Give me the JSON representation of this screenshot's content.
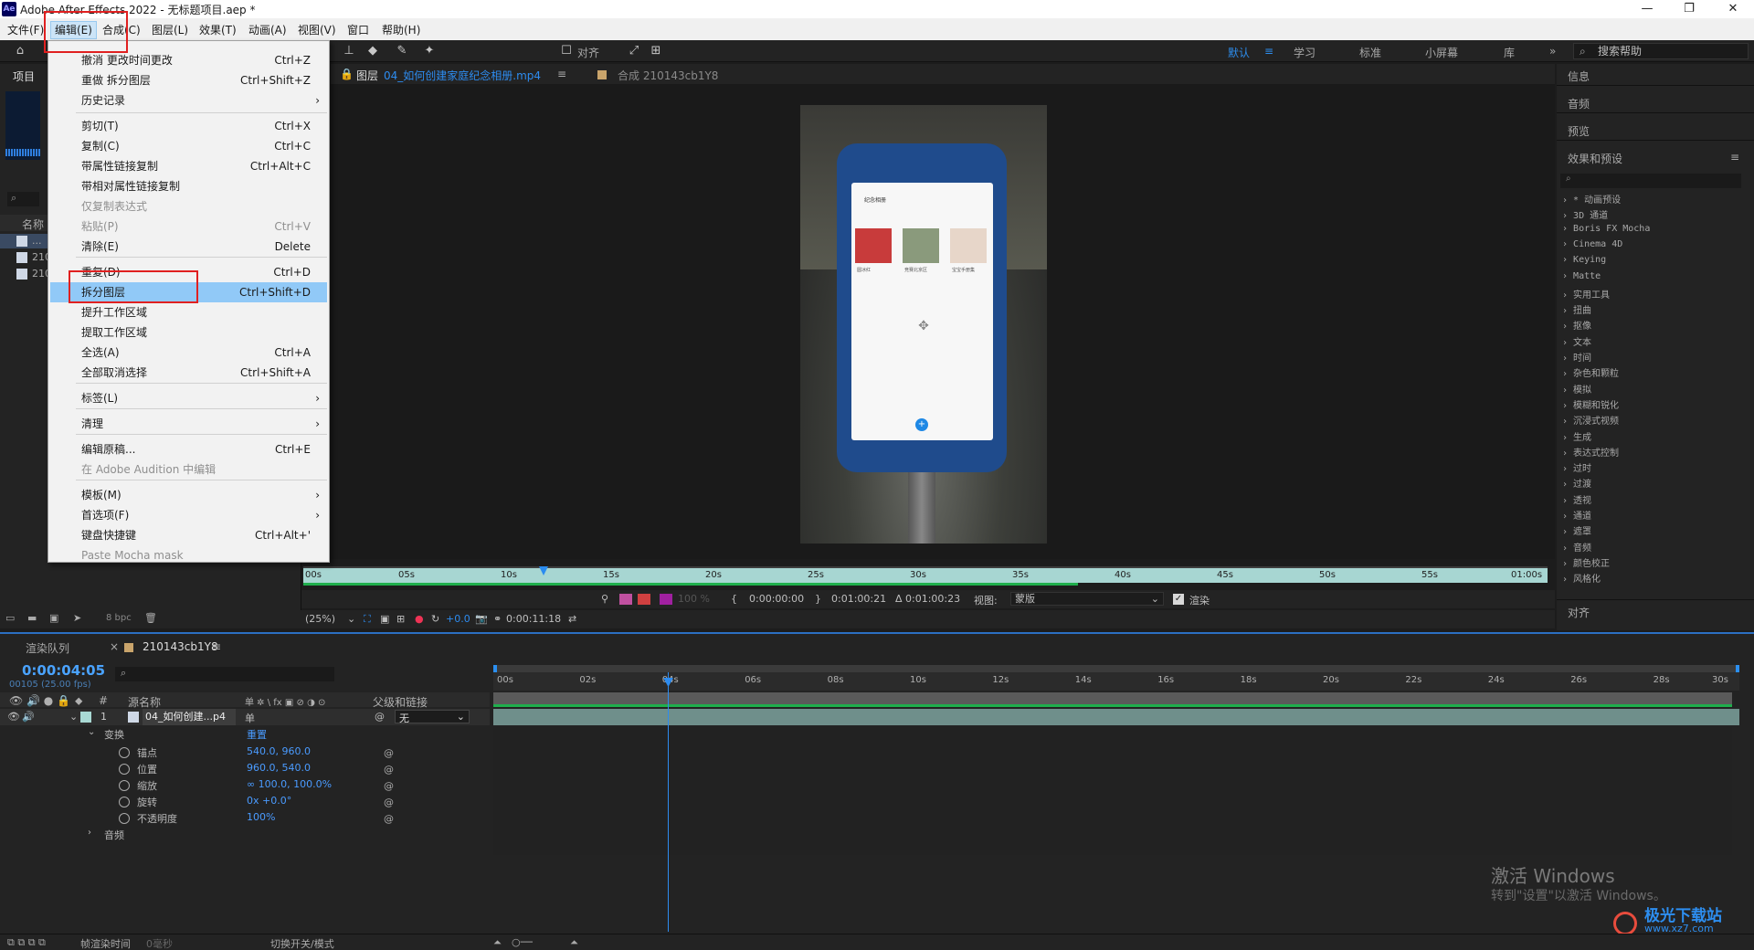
{
  "window": {
    "app_logo": "Ae",
    "title": "Adobe After Effects 2022 - 无标题项目.aep *",
    "minimize": "—",
    "maximize": "❐",
    "close": "✕"
  },
  "menubar": [
    "文件(F)",
    "编辑(E)",
    "合成(C)",
    "图层(L)",
    "效果(T)",
    "动画(A)",
    "视图(V)",
    "窗口",
    "帮助(H)"
  ],
  "toolbar": {
    "align_label": "对齐",
    "workspaces": [
      "默认",
      "学习",
      "标准",
      "小屏幕",
      "库"
    ],
    "active_workspace": "默认",
    "more": "»",
    "search_placeholder": "搜索帮助"
  },
  "edit_menu": {
    "items": [
      {
        "label": "撤消 更改时间更改",
        "shortcut": "Ctrl+Z"
      },
      {
        "label": "重做 拆分图层",
        "shortcut": "Ctrl+Shift+Z"
      },
      {
        "label": "历史记录",
        "shortcut": "",
        "arrow": "›"
      },
      {
        "label": "剪切(T)",
        "shortcut": "Ctrl+X"
      },
      {
        "label": "复制(C)",
        "shortcut": "Ctrl+C"
      },
      {
        "label": "带属性链接复制",
        "shortcut": "Ctrl+Alt+C"
      },
      {
        "label": "带相对属性链接复制",
        "shortcut": ""
      },
      {
        "label": "仅复制表达式",
        "shortcut": "",
        "disabled": true
      },
      {
        "label": "粘贴(P)",
        "shortcut": "Ctrl+V",
        "disabled": true
      },
      {
        "label": "清除(E)",
        "shortcut": "Delete"
      },
      {
        "label": "重复(D)",
        "shortcut": "Ctrl+D"
      },
      {
        "label": "拆分图层",
        "shortcut": "Ctrl+Shift+D",
        "highlighted": true
      },
      {
        "label": "提升工作区域",
        "shortcut": ""
      },
      {
        "label": "提取工作区域",
        "shortcut": ""
      },
      {
        "label": "全选(A)",
        "shortcut": "Ctrl+A"
      },
      {
        "label": "全部取消选择",
        "shortcut": "Ctrl+Shift+A"
      },
      {
        "label": "标签(L)",
        "shortcut": "",
        "arrow": "›"
      },
      {
        "label": "清理",
        "shortcut": "",
        "arrow": "›"
      },
      {
        "label": "编辑原稿...",
        "shortcut": "Ctrl+E"
      },
      {
        "label": "在 Adobe Audition 中编辑",
        "shortcut": "",
        "disabled": true
      },
      {
        "label": "模板(M)",
        "shortcut": "",
        "arrow": "›"
      },
      {
        "label": "首选项(F)",
        "shortcut": "",
        "arrow": "›"
      },
      {
        "label": "键盘快捷键",
        "shortcut": "Ctrl+Alt+'"
      },
      {
        "label": "Paste Mocha mask",
        "shortcut": "",
        "disabled": true
      }
    ]
  },
  "project_panel": {
    "tab": "项目",
    "search_glyph": "⌕",
    "col_name": "名称",
    "rows": [
      "...",
      "210",
      "210"
    ],
    "bpc": "8 bpc"
  },
  "viewer": {
    "lock": "🔒",
    "layer_tab_prefix": "图层",
    "layer_tab_name": "04_如何创建家庭纪念相册.mp4",
    "menu_glyph": "≡",
    "comp_tab": "合成 210143cb1Y8",
    "phone_header": "纪念相册",
    "photo_captions": [
      "圆冰红",
      "竞赛北京区",
      "宝宝手册集"
    ],
    "fab": "+",
    "anchor": "✥",
    "ruler_ticks": [
      "00s",
      "05s",
      "10s",
      "15s",
      "20s",
      "25s",
      "30s",
      "35s",
      "40s",
      "45s",
      "50s",
      "55s",
      "01:00s"
    ],
    "in_time": "0:00:00:00",
    "out_time": "0:01:00:21",
    "duration": "Δ 0:01:00:23",
    "view_label": "视图:",
    "view_value": "蒙版",
    "render_label": "渲染",
    "zoom": "(25%)",
    "exposure": "+0.0",
    "current_time": "0:00:11:18",
    "opacity_pct": "100 %"
  },
  "right_panel": {
    "info": "信息",
    "audio": "音频",
    "preview": "预览",
    "effects_title": "效果和预设",
    "effects_search": "⌕",
    "effects": [
      "* 动画预设",
      "3D 通道",
      "Boris FX Mocha",
      "Cinema 4D",
      "Keying",
      "Matte",
      "实用工具",
      "扭曲",
      "抠像",
      "文本",
      "时间",
      "杂色和颗粒",
      "模拟",
      "模糊和锐化",
      "沉浸式视频",
      "生成",
      "表达式控制",
      "过时",
      "过渡",
      "透视",
      "通道",
      "遮罩",
      "音频",
      "颜色校正",
      "风格化"
    ],
    "align": "对齐"
  },
  "timeline": {
    "tab_render": "渲染队列",
    "tab_comp": "210143cb1Y8",
    "current_time": "0:00:04:05",
    "frames": "00105 (25.00 fps)",
    "col_source": "源名称",
    "col_switches": "单 ✲ \\ fx ▣ ⊘ ◑ ⊙",
    "col_parent": "父级和链接",
    "layer_index": "1",
    "layer_name": "04_如何创建...p4",
    "layer_parent": "无",
    "transform": "变换",
    "reset": "重置",
    "properties": [
      {
        "name": "锚点",
        "value": "540.0, 960.0"
      },
      {
        "name": "位置",
        "value": "960.0, 540.0"
      },
      {
        "name": "缩放",
        "value": "∞ 100.0, 100.0%"
      },
      {
        "name": "旋转",
        "value": "0x +0.0°"
      },
      {
        "name": "不透明度",
        "value": "100%"
      }
    ],
    "audio": "音频",
    "ruler_ticks": [
      "00s",
      "02s",
      "04s",
      "06s",
      "08s",
      "10s",
      "12s",
      "14s",
      "16s",
      "18s",
      "20s",
      "22s",
      "24s",
      "26s",
      "28s",
      "30s"
    ],
    "footer_render_time": "帧渲染时间",
    "footer_ms": "0毫秒",
    "footer_toggle": "切换开关/模式"
  },
  "overlay": {
    "activate_windows": "激活 Windows",
    "activate_hint": "转到\"设置\"以激活 Windows。",
    "site_name": "极光下载站",
    "site_url": "www.xz7.com"
  }
}
